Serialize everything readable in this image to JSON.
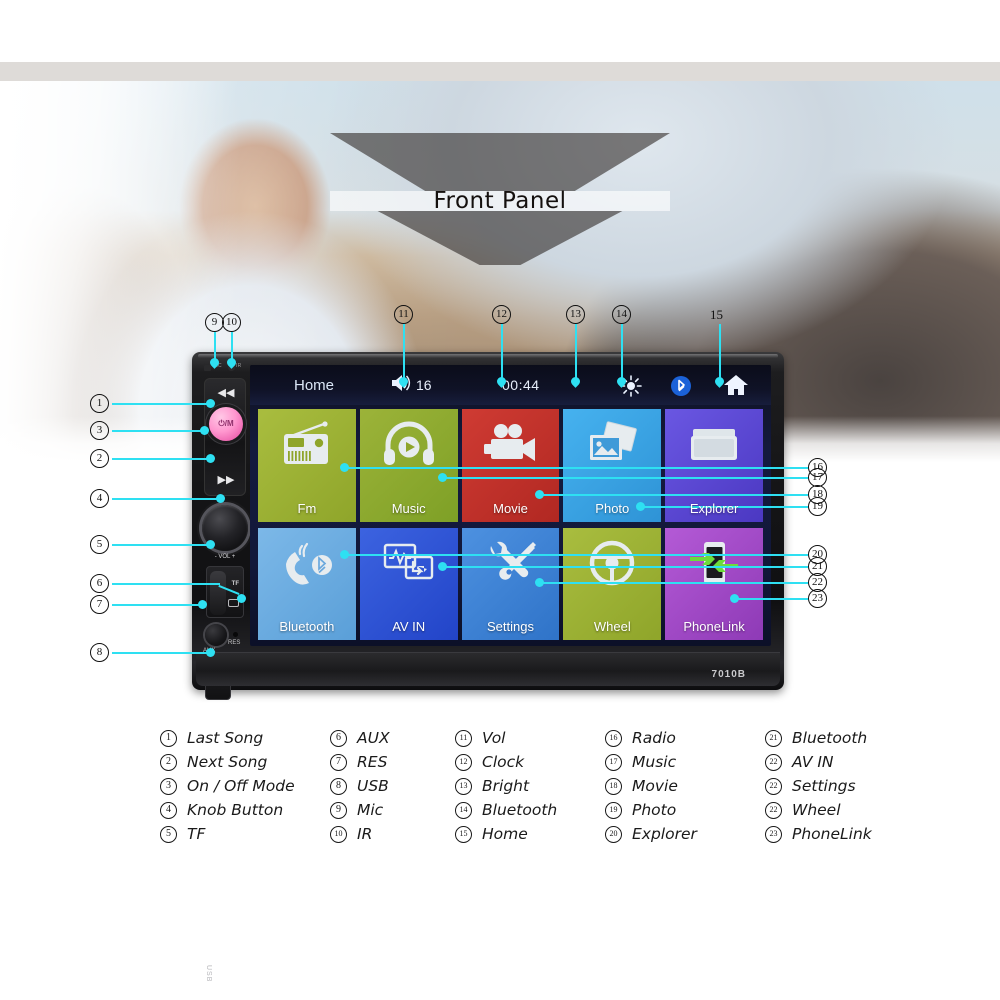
{
  "banner": {
    "title": "Front Panel"
  },
  "unit": {
    "model": "7010B",
    "bezel_labels": {
      "mic": "MIC",
      "ir": "IR",
      "vol": "- VOL +",
      "tf": "TF",
      "aux": "AUX",
      "res": "RES",
      "usb": "USB",
      "power": "⏻/M"
    }
  },
  "screen": {
    "statusbar": {
      "home_label": "Home",
      "volume_icon": "speaker-icon",
      "volume_value": "16",
      "clock": "00:44",
      "bright_icon": "sun-icon",
      "bluetooth_icon": "bluetooth-icon",
      "home_icon": "house-icon"
    },
    "tiles_row1": [
      {
        "label": "Fm",
        "icon": "radio-icon",
        "color": "#9bb033"
      },
      {
        "label": "Music",
        "icon": "headphone-icon",
        "color": "#8fb02e"
      },
      {
        "label": "Movie",
        "icon": "camcorder-icon",
        "color": "#c4302b"
      },
      {
        "label": "Photo",
        "icon": "picture-icon",
        "color": "#3aa7e8"
      },
      {
        "label": "Explorer",
        "icon": "folder-icon",
        "color": "#5b49d6"
      }
    ],
    "tiles_row2": [
      {
        "label": "Bluetooth",
        "icon": "phone-bluetooth-icon",
        "color": "#63a8e0"
      },
      {
        "label": "AV IN",
        "icon": "av-in-icon",
        "color": "#2b55d8"
      },
      {
        "label": "Settings",
        "icon": "tools-icon",
        "color": "#3d7fd4"
      },
      {
        "label": "Wheel",
        "icon": "steering-wheel-icon",
        "color": "#9bb033"
      },
      {
        "label": "PhoneLink",
        "icon": "phonelink-icon",
        "color": "#a44bc9"
      }
    ]
  },
  "callouts": {
    "left": [
      "1",
      "3",
      "2",
      "4",
      "5",
      "6",
      "7",
      "8"
    ],
    "top": [
      "9",
      "10",
      "11",
      "12",
      "13",
      "14",
      "15"
    ],
    "right_top": [
      "16",
      "17",
      "18",
      "19"
    ],
    "right_bottom": [
      "20",
      "21",
      "22",
      "23"
    ]
  },
  "legend": {
    "col1": [
      {
        "num": "1",
        "text": "Last Song"
      },
      {
        "num": "2",
        "text": "Next Song"
      },
      {
        "num": "3",
        "text": "On / Off Mode"
      },
      {
        "num": "4",
        "text": "Knob Button"
      },
      {
        "num": "5",
        "text": "TF"
      }
    ],
    "col2": [
      {
        "num": "6",
        "text": "AUX"
      },
      {
        "num": "7",
        "text": "RES"
      },
      {
        "num": "8",
        "text": "USB"
      },
      {
        "num": "9",
        "text": "Mic"
      },
      {
        "num": "10",
        "text": "IR"
      }
    ],
    "col3": [
      {
        "num": "11",
        "text": "Vol"
      },
      {
        "num": "12",
        "text": "Clock"
      },
      {
        "num": "13",
        "text": "Bright"
      },
      {
        "num": "14",
        "text": "Bluetooth"
      },
      {
        "num": "15",
        "text": "Home"
      }
    ],
    "col4": [
      {
        "num": "16",
        "text": "Radio"
      },
      {
        "num": "17",
        "text": "Music"
      },
      {
        "num": "18",
        "text": "Movie"
      },
      {
        "num": "19",
        "text": "Photo"
      },
      {
        "num": "20",
        "text": "Explorer"
      }
    ],
    "col5": [
      {
        "num": "21",
        "text": "Bluetooth"
      },
      {
        "num": "22",
        "text": " AV IN"
      },
      {
        "num": "22",
        "text": "Settings"
      },
      {
        "num": "22",
        "text": "Wheel"
      },
      {
        "num": "23",
        "text": "PhoneLink"
      }
    ]
  },
  "colors": {
    "callout_cyan": "#2ee0f2",
    "legend_ink": "#1a1a1a"
  }
}
